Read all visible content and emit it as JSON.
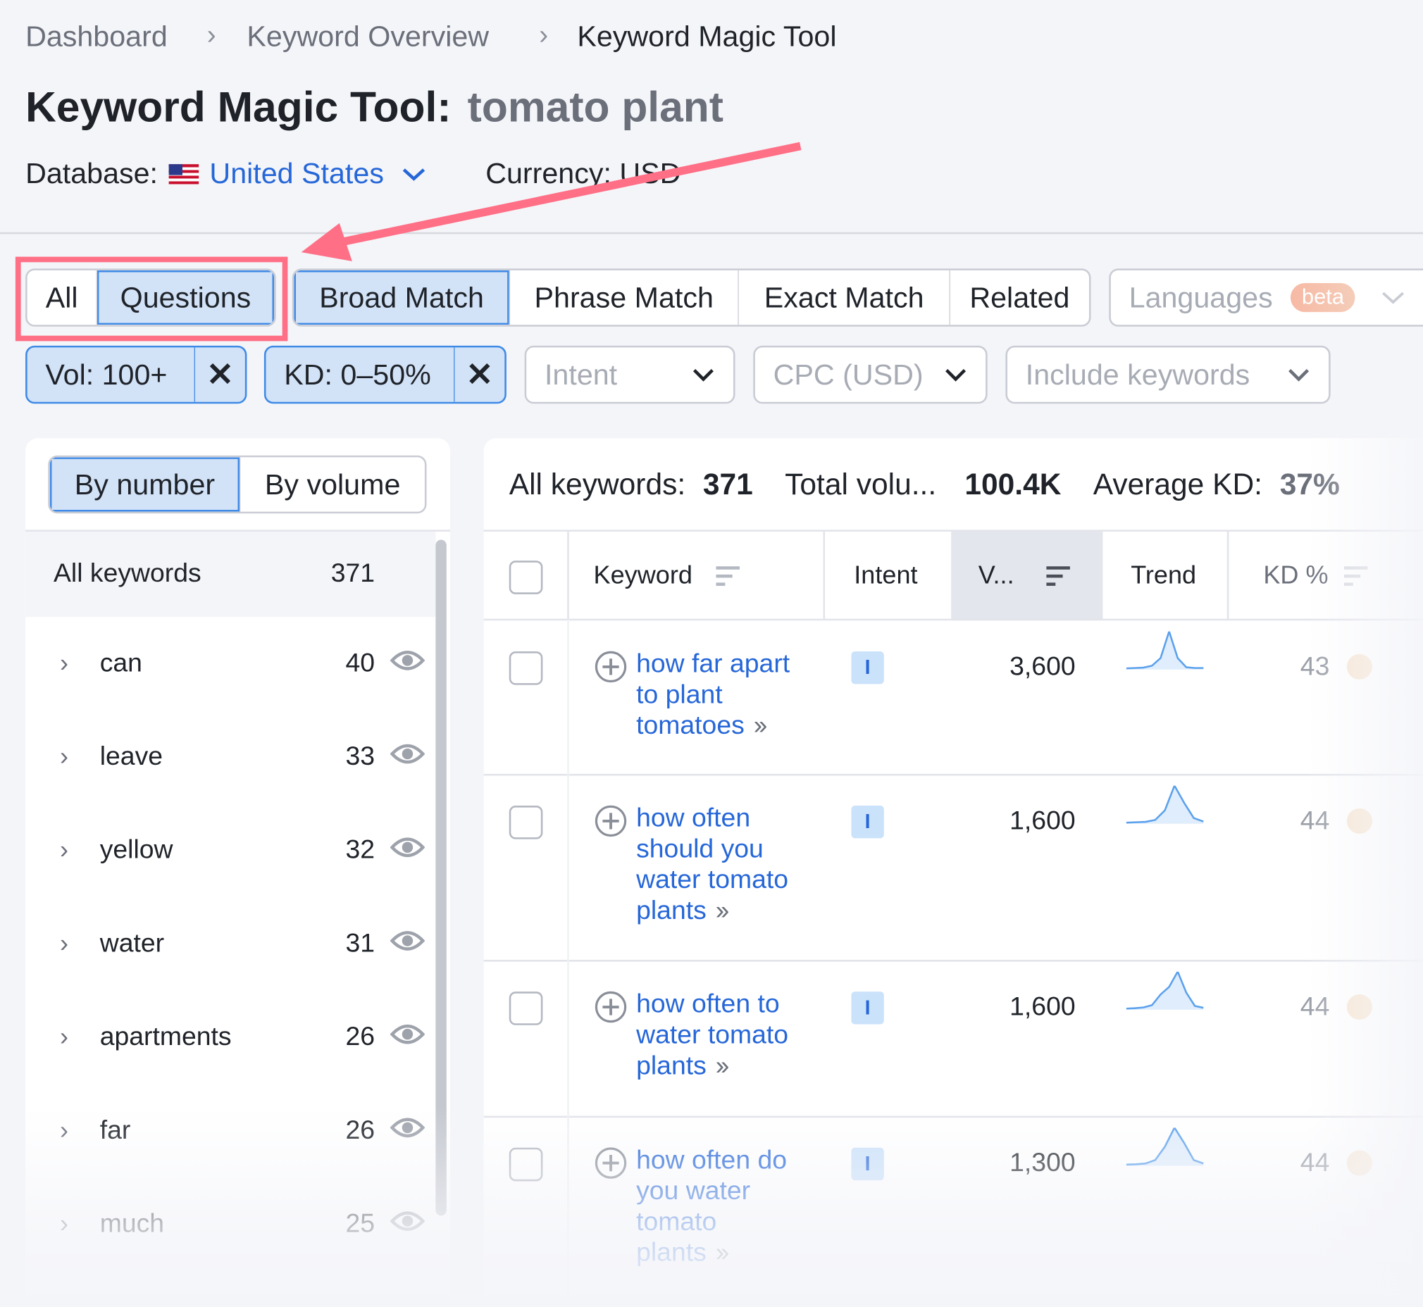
{
  "breadcrumb": [
    "Dashboard",
    "Keyword Overview",
    "Keyword Magic Tool"
  ],
  "title": {
    "label": "Keyword Magic Tool:",
    "query": "tomato plant"
  },
  "database": {
    "label": "Database:",
    "value": "United States",
    "currency": "Currency: USD"
  },
  "match_tabs": {
    "group1": [
      "All",
      "Questions"
    ],
    "group1_selected": "Questions",
    "group2": [
      "Broad Match",
      "Phrase Match",
      "Exact Match",
      "Related"
    ],
    "group2_selected": "Broad Match",
    "languages": "Languages",
    "beta": "beta"
  },
  "filters": {
    "vol": "Vol: 100+",
    "kd": "KD: 0–50%",
    "intent": "Intent",
    "cpc": "CPC (USD)",
    "include": "Include keywords"
  },
  "groups": {
    "by_number": "By number",
    "by_volume": "By volume",
    "all_label": "All keywords",
    "all_count": "371",
    "items": [
      {
        "label": "can",
        "count": "40"
      },
      {
        "label": "leave",
        "count": "33"
      },
      {
        "label": "yellow",
        "count": "32"
      },
      {
        "label": "water",
        "count": "31"
      },
      {
        "label": "apartments",
        "count": "26"
      },
      {
        "label": "far",
        "count": "26"
      },
      {
        "label": "much",
        "count": "25"
      }
    ]
  },
  "summary": {
    "all_label": "All keywords:",
    "all_value": "371",
    "total_label": "Total volu...",
    "total_value": "100.4K",
    "kd_label": "Average KD:",
    "kd_value": "37%"
  },
  "table": {
    "headers": {
      "keyword": "Keyword",
      "intent": "Intent",
      "volume": "V...",
      "trend": "Trend",
      "kd": "KD %"
    },
    "rows": [
      {
        "keyword": [
          "how far apart",
          "to plant",
          "tomatoes"
        ],
        "intent": "I",
        "volume": "3,600",
        "kd": "43",
        "trend": [
          3,
          4,
          5,
          10,
          30,
          100,
          30,
          6,
          4,
          4
        ]
      },
      {
        "keyword": [
          "how often",
          "should you",
          "water tomato",
          "plants"
        ],
        "intent": "I",
        "volume": "1,600",
        "kd": "44",
        "trend": [
          3,
          4,
          5,
          10,
          35,
          100,
          55,
          15,
          6
        ]
      },
      {
        "keyword": [
          "how often to",
          "water tomato",
          "plants"
        ],
        "intent": "I",
        "volume": "1,600",
        "kd": "44",
        "trend": [
          3,
          4,
          6,
          12,
          40,
          60,
          100,
          45,
          10,
          5
        ]
      },
      {
        "keyword": [
          "how often do",
          "you water",
          "tomato",
          "plants"
        ],
        "intent": "I",
        "volume": "1,300",
        "kd": "44",
        "trend": [
          3,
          4,
          6,
          15,
          50,
          100,
          60,
          15,
          6
        ]
      }
    ]
  },
  "colors": {
    "accent": "#2667d8",
    "selected_bg": "#d2e2f7",
    "annotation": "#ff6f86",
    "kd_dot": "#f8e6d2"
  }
}
